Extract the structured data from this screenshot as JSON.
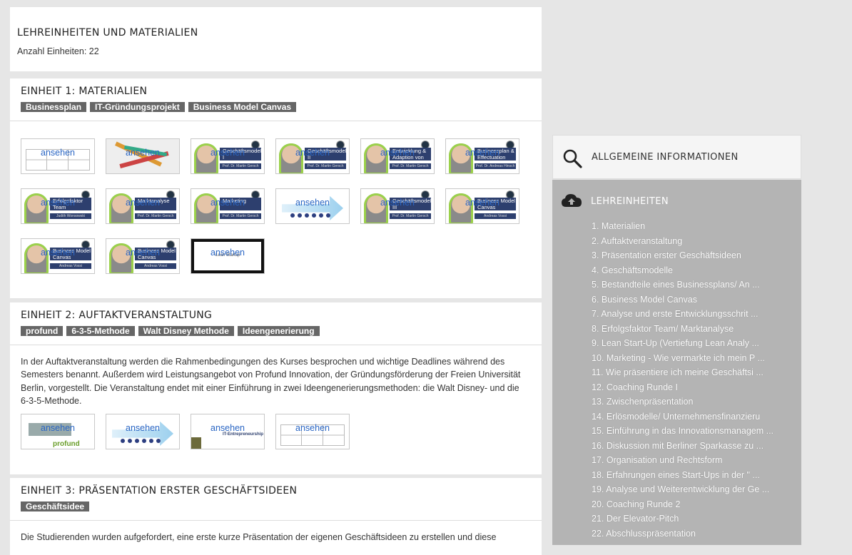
{
  "header": {
    "title": "LEHREINHEITEN UND MATERIALIEN",
    "count": "Anzahl Einheiten: 22"
  },
  "units": [
    {
      "title": "EINHEIT 1: MATERIALIEN",
      "tags": [
        "Businessplan",
        "IT-Gründungsprojekt",
        "Business Model Canvas"
      ],
      "thumbnails": [
        {
          "view": "ansehen",
          "kind": "grid",
          "caption": ""
        },
        {
          "view": "ansehen",
          "kind": "arrows",
          "caption": ""
        },
        {
          "view": "ansehen",
          "kind": "person",
          "caption": "Geschäftsmodelle I",
          "sub": "Prof. Dr. Martin Gersch"
        },
        {
          "view": "ansehen",
          "kind": "person",
          "caption": "Geschäftsmodelle II",
          "sub": "Prof. Dr. Martin Gersch"
        },
        {
          "view": "ansehen",
          "kind": "person",
          "caption": "Entwicklung & Adaption von Geschäftsmodellen",
          "sub": "Prof. Dr. Martin Gersch"
        },
        {
          "view": "ansehen",
          "kind": "person",
          "caption": "Businessplan & Effectuation",
          "sub": "Prof. Dr. Andreas Hinsch"
        },
        {
          "view": "ansehen",
          "kind": "person",
          "caption": "Erfolgsfaktor Team",
          "sub": "Judith Wonsowski"
        },
        {
          "view": "ansehen",
          "kind": "person",
          "caption": "Marktanalyse",
          "sub": "Prof. Dr. Martin Gersch"
        },
        {
          "view": "ansehen",
          "kind": "person",
          "caption": "Marketing",
          "sub": "Prof. Dr. Martin Gersch"
        },
        {
          "view": "ansehen",
          "kind": "flow",
          "caption": ""
        },
        {
          "view": "ansehen",
          "kind": "person",
          "caption": "Geschäftsmodelle III",
          "sub": "Prof. Dr. Martin Gersch"
        },
        {
          "view": "ansehen",
          "kind": "person",
          "caption": "Business Model Canvas",
          "sub": "Andreas Vossi"
        },
        {
          "view": "ansehen",
          "kind": "person",
          "caption": "Business Model Canvas (Mobilität)",
          "sub": "Andreas Vossi"
        },
        {
          "view": "ansehen",
          "kind": "person",
          "caption": "Business Model Canvas (Forschungsergebnisse)",
          "sub": "Andreas Vossi"
        },
        {
          "view": "ansehen",
          "kind": "dark",
          "caption": "Lean Startup"
        }
      ]
    },
    {
      "title": "EINHEIT 2: AUFTAKTVERANSTALTUNG",
      "tags": [
        "profund",
        "6-3-5-Methode",
        "Walt Disney Methode",
        "Ideengenerierung"
      ],
      "description": "In der Auftaktveranstaltung werden die Rahmenbedingungen des Kurses besprochen und wichtige Deadlines während des Semesters benannt. Außerdem wird Leistungsangebot von Profund Innovation, der Gründungsförderung der Freien Universität Berlin, vorgestellt. Die Veranstaltung endet mit einer Einführung in zwei Ideengenerierungsmethoden: die Walt Disney- und die 6-3-5-Methode.",
      "thumbnails": [
        {
          "view": "ansehen",
          "kind": "profund",
          "caption": "profund"
        },
        {
          "view": "ansehen",
          "kind": "flow",
          "caption": ""
        },
        {
          "view": "ansehen",
          "kind": "entre",
          "caption": "IT-Entrepreneurship"
        },
        {
          "view": "ansehen",
          "kind": "grid",
          "caption": ""
        }
      ]
    },
    {
      "title": "EINHEIT 3: PRÄSENTATION ERSTER GESCHÄFTSIDEEN",
      "tags": [
        "Geschäftsidee"
      ],
      "description": "Die Studierenden wurden aufgefordert, eine erste kurze Präsentation der eigenen Geschäftsideen zu erstellen und diese"
    }
  ],
  "sidebar": {
    "general_label": "ALLGEMEINE INFORMATIONEN",
    "general_icon": "search-icon",
    "units_label": "LEHREINHEITEN",
    "units_icon": "cloud-upload-icon",
    "items": [
      "1. Materialien",
      "2. Auftaktveranstaltung",
      "3. Präsentation erster Geschäftsideen",
      "4. Geschäftsmodelle",
      "5. Bestandteile eines Businessplans/ An ...",
      "6. Business Model Canvas",
      "7. Analyse und erste Entwicklungsschrit ...",
      "8. Erfolgsfaktor Team/ Marktanalyse",
      "9. Lean Start-Up (Vertiefung Lean Analy ...",
      "10. Marketing - Wie vermarkte ich mein P ...",
      "11. Wie präsentiere ich meine Geschäftsi ...",
      "12. Coaching Runde I",
      "13. Zwischenpräsentation",
      "14. Erlösmodelle/ Unternehmensfinanzieru",
      "15. Einführung in das Innovationsmanagem ...",
      "16. Diskussion mit Berliner Sparkasse zu ...",
      "17. Organisation und Rechtsform",
      "18. Erfahrungen eines Start-Ups in der \" ...",
      "19. Analyse und Weiterentwicklung der Ge ...",
      "20. Coaching Runde 2",
      "21. Der Elevator-Pitch",
      "22. Abschlusspräsentation"
    ]
  },
  "colors": {
    "page_bg": "#e6e6e6",
    "tag_bg": "#666666",
    "link": "#2a66c4",
    "sidebar_active": "#b4b4b4"
  }
}
